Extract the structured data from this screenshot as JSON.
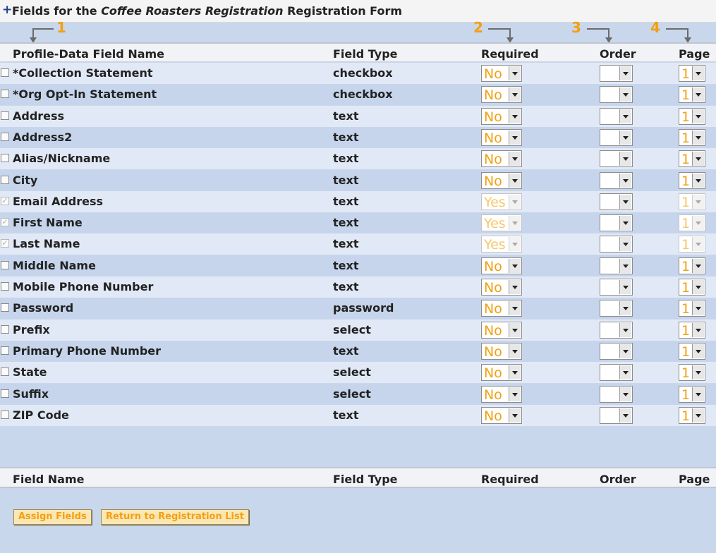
{
  "title": {
    "prefix": "Fields for the",
    "form_name": "Coffee Roasters Registration",
    "suffix": "Registration Form"
  },
  "annotations": [
    "1",
    "2",
    "3",
    "4"
  ],
  "columns": {
    "name": "Profile-Data Field Name",
    "type": "Field Type",
    "required": "Required",
    "order": "Order",
    "page": "Page"
  },
  "footer_columns": {
    "name": "Field Name",
    "type": "Field Type",
    "required": "Required",
    "order": "Order",
    "page": "Page"
  },
  "rows": [
    {
      "name": "*Collection Statement",
      "type": "checkbox",
      "required": "No",
      "order": "",
      "page": "1",
      "checked": false,
      "locked": false
    },
    {
      "name": "*Org Opt-In Statement",
      "type": "checkbox",
      "required": "No",
      "order": "",
      "page": "1",
      "checked": false,
      "locked": false
    },
    {
      "name": "Address",
      "type": "text",
      "required": "No",
      "order": "",
      "page": "1",
      "checked": false,
      "locked": false
    },
    {
      "name": "Address2",
      "type": "text",
      "required": "No",
      "order": "",
      "page": "1",
      "checked": false,
      "locked": false
    },
    {
      "name": "Alias/Nickname",
      "type": "text",
      "required": "No",
      "order": "",
      "page": "1",
      "checked": false,
      "locked": false
    },
    {
      "name": "City",
      "type": "text",
      "required": "No",
      "order": "",
      "page": "1",
      "checked": false,
      "locked": false
    },
    {
      "name": "Email Address",
      "type": "text",
      "required": "Yes",
      "order": "",
      "page": "1",
      "checked": true,
      "locked": true
    },
    {
      "name": "First Name",
      "type": "text",
      "required": "Yes",
      "order": "",
      "page": "1",
      "checked": true,
      "locked": true
    },
    {
      "name": "Last Name",
      "type": "text",
      "required": "Yes",
      "order": "",
      "page": "1",
      "checked": true,
      "locked": true
    },
    {
      "name": "Middle Name",
      "type": "text",
      "required": "No",
      "order": "",
      "page": "1",
      "checked": false,
      "locked": false
    },
    {
      "name": "Mobile Phone Number",
      "type": "text",
      "required": "No",
      "order": "",
      "page": "1",
      "checked": false,
      "locked": false
    },
    {
      "name": "Password",
      "type": "password",
      "required": "No",
      "order": "",
      "page": "1",
      "checked": false,
      "locked": false
    },
    {
      "name": "Prefix",
      "type": "select",
      "required": "No",
      "order": "",
      "page": "1",
      "checked": false,
      "locked": false
    },
    {
      "name": "Primary Phone Number",
      "type": "text",
      "required": "No",
      "order": "",
      "page": "1",
      "checked": false,
      "locked": false
    },
    {
      "name": "State",
      "type": "select",
      "required": "No",
      "order": "",
      "page": "1",
      "checked": false,
      "locked": false
    },
    {
      "name": "Suffix",
      "type": "select",
      "required": "No",
      "order": "",
      "page": "1",
      "checked": false,
      "locked": false
    },
    {
      "name": "ZIP Code",
      "type": "text",
      "required": "No",
      "order": "",
      "page": "1",
      "checked": false,
      "locked": false
    }
  ],
  "buttons": {
    "assign": "Assign Fields",
    "return": "Return to Registration List"
  },
  "colors": {
    "accent": "#f2a012",
    "row_light": "#e2e9f6",
    "row_dark": "#c6d5ec",
    "panel": "#c9d7ec"
  }
}
